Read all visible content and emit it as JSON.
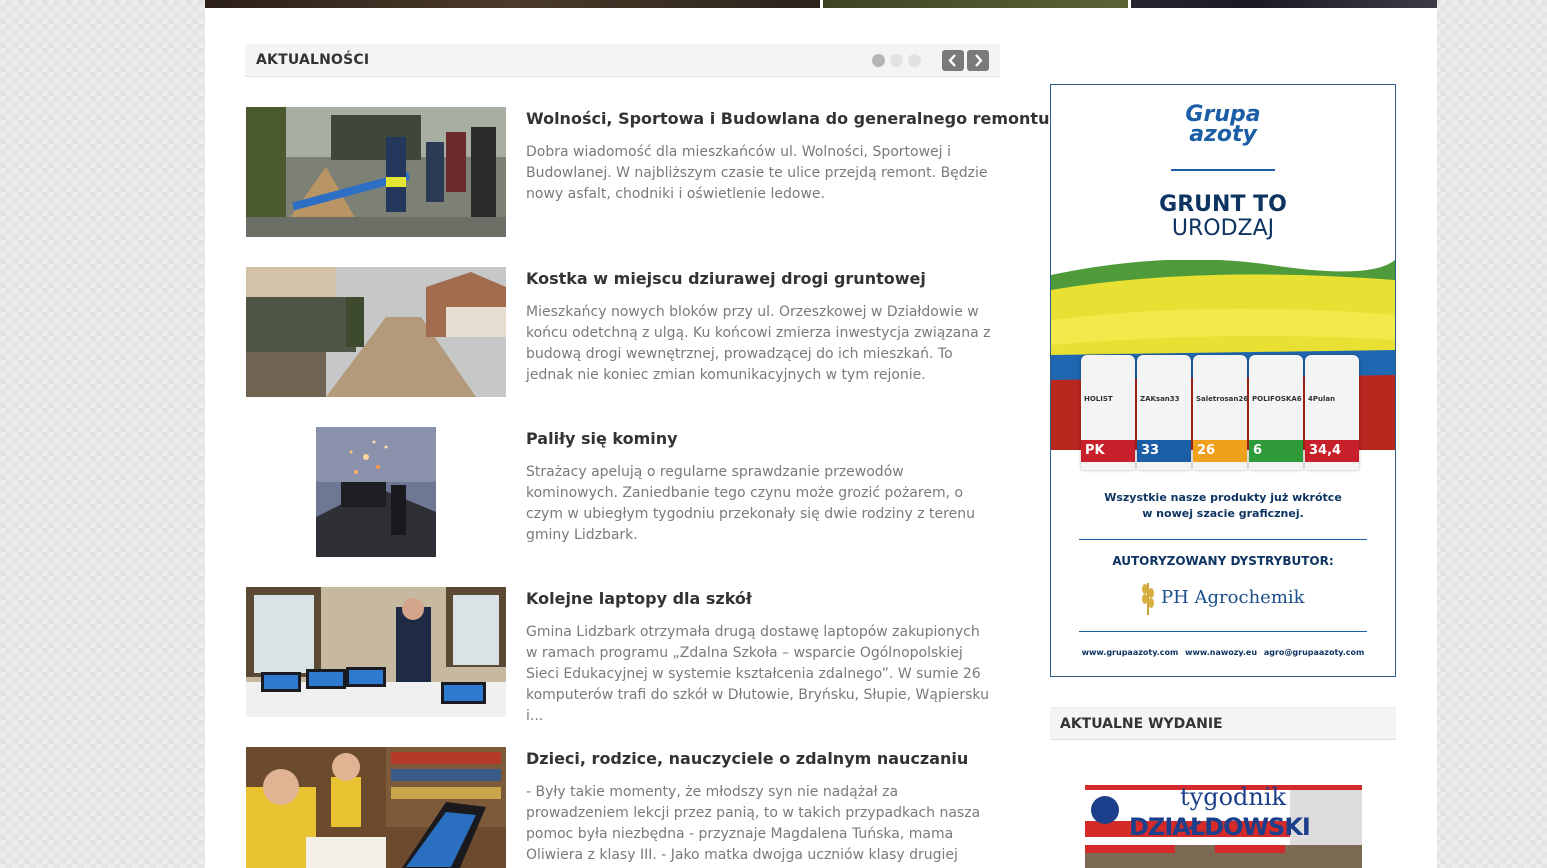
{
  "news": {
    "title": "AKTUALNOŚCI",
    "prev_label": "‹",
    "next_label": "›",
    "articles": [
      {
        "title": "Wolności, Sportowa i Budowlana do generalnego remontu",
        "text": "Dobra wiadomość dla mieszkańców ul. Wolności, Sportowej i Budowlanej. W najbliższym czasie te ulice przejdą remont. Będzie nowy asfalt, chodniki i oświetlenie ledowe."
      },
      {
        "title": "Kostka w miejscu dziurawej drogi gruntowej",
        "text": "Mieszkańcy nowych bloków przy ul. Orzeszkowej w Działdowie w końcu odetchną z ulgą. Ku końcowi zmierza inwestycja związana z budową drogi wewnętrznej, prowadzącej do ich mieszkań. To jednak nie koniec zmian komunikacyjnych w tym rejonie."
      },
      {
        "title": "Paliły się kominy",
        "text": "Strażacy apelują o regularne sprawdzanie przewodów kominowych. Zaniedbanie tego czynu może grozić pożarem, o czym w ubiegłym tygodniu przekonały się dwie rodziny z terenu gminy Lidzbark."
      },
      {
        "title": "Kolejne laptopy dla szkół",
        "text": "Gmina Lidzbark otrzymała drugą dostawę laptopów zakupionych w ramach programu „Zdalna Szkoła – wsparcie Ogólnopolskiej Sieci Edukacyjnej w systemie kształcenia zdalnego”. W sumie 26 komputerów trafi do szkół w Dłutowie, Bryńsku, Słupie, Wąpiersku i..."
      },
      {
        "title": "Dzieci, rodzice, nauczyciele o zdalnym nauczaniu",
        "text": "- Były takie momenty, że młodszy syn nie nadążał za prowadzeniem lekcji przez panią, to w takich przypadkach nasza pomoc była niezbędna - przyznaje Magdalena Tuńska, mama Oliwiera z klasy III. - Jako matka dwojga uczniów klasy drugiej szkoły..."
      }
    ]
  },
  "ad": {
    "logo_line1": "Grupa",
    "logo_line2": "azoty",
    "slogan_line1": "GRUNT TO",
    "slogan_line2": "URODZAJ",
    "bags": [
      {
        "name": "HOLIST",
        "num": "PK",
        "color": "#c8202a"
      },
      {
        "name": "ZAKsan33",
        "num": "33",
        "color": "#1b5ea6"
      },
      {
        "name": "Saletrosan26",
        "num": "26",
        "color": "#f0a11c"
      },
      {
        "name": "POLIFOSKA6",
        "num": "6",
        "color": "#2e9a3a"
      },
      {
        "name": "4Pulan",
        "num": "34,4",
        "color": "#c8202a"
      }
    ],
    "info_line1": "Wszystkie nasze produkty już wkrótce",
    "info_line2": "w nowej szacie graficznej.",
    "distributor": "AUTORYZOWANY DYSTRYBUTOR:",
    "distributor_name": "PH Agrochemik",
    "contacts": "www.grupaazoty.com www.nawozy.eu agro@grupaazoty.com"
  },
  "sidebar": {
    "issue_title": "AKTUALNE WYDANIE",
    "paper_name_1": "tygodnik",
    "paper_name_2": "DZIAŁDOWSKI"
  }
}
